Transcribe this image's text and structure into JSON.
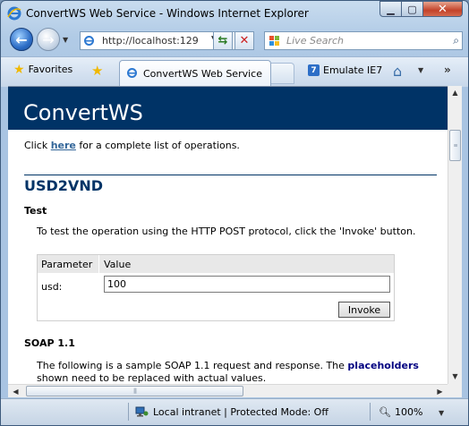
{
  "window": {
    "title": "ConvertWS Web Service - Windows Internet Explorer"
  },
  "nav": {
    "address": "http://localhost:129",
    "search_placeholder": "Live Search"
  },
  "favbar": {
    "favorites_label": "Favorites",
    "tab_label": "ConvertWS Web Service",
    "emulate_label": "Emulate IE7",
    "emulate_icon_text": "7"
  },
  "page": {
    "header_title": "ConvertWS",
    "intro_prefix": "Click ",
    "intro_link": "here",
    "intro_suffix": " for a complete list of operations.",
    "operation_name": "USD2VND",
    "test_heading": "Test",
    "test_description": "To test the operation using the HTTP POST protocol, click the 'Invoke' button.",
    "form": {
      "col_parameter": "Parameter",
      "col_value": "Value",
      "param_label": "usd:",
      "param_value": "100",
      "invoke_label": "Invoke"
    },
    "soap_heading": "SOAP 1.1",
    "soap_desc_part1": "The following is a sample SOAP 1.1 request and response. The ",
    "soap_desc_bold": "placeholders",
    "soap_desc_line2": "shown need to be replaced with actual values."
  },
  "status": {
    "zone_text": "Local intranet | Protected Mode: Off",
    "zoom": "100%"
  },
  "colors": {
    "header_band": "#003366",
    "link": "#336699",
    "operation_title": "#003366",
    "placeholders_text": "#000080"
  }
}
